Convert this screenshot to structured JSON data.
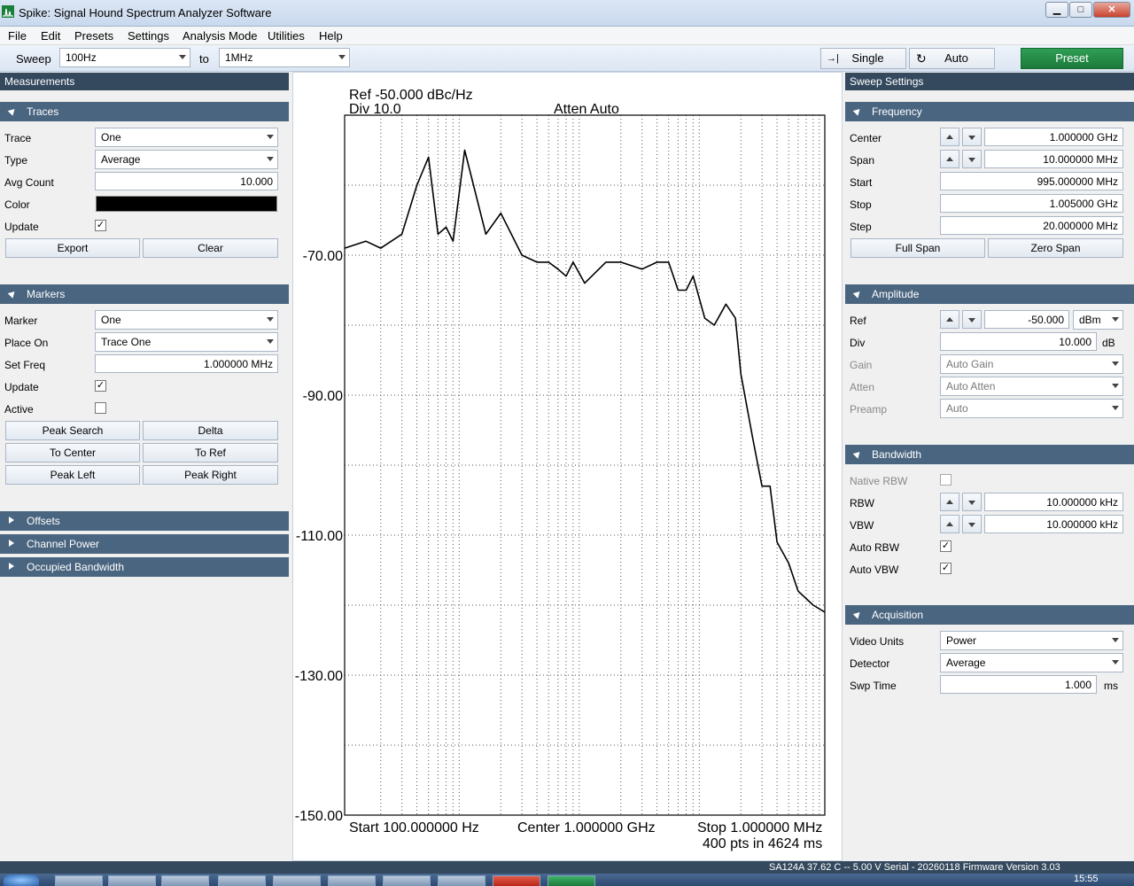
{
  "window": {
    "title": "Spike: Signal Hound Spectrum Analyzer Software",
    "minimize": "▁",
    "maximize": "□",
    "close": "✕"
  },
  "menu": [
    "File",
    "Edit",
    "Presets",
    "Settings",
    "Analysis Mode",
    "Utilities",
    "Help"
  ],
  "toolbar": {
    "sweep_label": "Sweep",
    "from": "100Hz",
    "to_label": "to",
    "to": "1MHz",
    "single": "Single",
    "auto": "Auto",
    "preset": "Preset"
  },
  "left": {
    "title": "Measurements",
    "traces": {
      "header": "Traces",
      "trace_label": "Trace",
      "trace": "One",
      "type_label": "Type",
      "type": "Average",
      "avg_label": "Avg Count",
      "avg": "10.000",
      "color_label": "Color",
      "update_label": "Update",
      "export": "Export",
      "clear": "Clear"
    },
    "markers": {
      "header": "Markers",
      "marker_label": "Marker",
      "marker": "One",
      "place_label": "Place On",
      "place": "Trace One",
      "setfreq_label": "Set Freq",
      "setfreq": "1.000000 MHz",
      "update_label": "Update",
      "active_label": "Active",
      "peak_search": "Peak Search",
      "delta": "Delta",
      "to_center": "To Center",
      "to_ref": "To Ref",
      "peak_left": "Peak Left",
      "peak_right": "Peak Right"
    },
    "offsets": "Offsets",
    "channel_power": "Channel Power",
    "occupied_bw": "Occupied Bandwidth"
  },
  "right": {
    "title": "Sweep Settings",
    "frequency": {
      "header": "Frequency",
      "center_label": "Center",
      "center": "1.000000 GHz",
      "span_label": "Span",
      "span": "10.000000 MHz",
      "start_label": "Start",
      "start": "995.000000 MHz",
      "stop_label": "Stop",
      "stop": "1.005000 GHz",
      "step_label": "Step",
      "step": "20.000000 MHz",
      "full_span": "Full Span",
      "zero_span": "Zero Span"
    },
    "amplitude": {
      "header": "Amplitude",
      "ref_label": "Ref",
      "ref": "-50.000",
      "ref_unit": "dBm",
      "div_label": "Div",
      "div": "10.000",
      "div_unit": "dB",
      "gain_label": "Gain",
      "gain": "Auto Gain",
      "atten_label": "Atten",
      "atten": "Auto Atten",
      "preamp_label": "Preamp",
      "preamp": "Auto"
    },
    "bandwidth": {
      "header": "Bandwidth",
      "native_label": "Native RBW",
      "rbw_label": "RBW",
      "rbw": "10.000000 kHz",
      "vbw_label": "VBW",
      "vbw": "10.000000 kHz",
      "auto_rbw_label": "Auto RBW",
      "auto_vbw_label": "Auto VBW"
    },
    "acquisition": {
      "header": "Acquisition",
      "video_label": "Video Units",
      "video": "Power",
      "detector_label": "Detector",
      "detector": "Average",
      "swp_label": "Swp Time",
      "swp": "1.000",
      "swp_unit": "ms"
    }
  },
  "plot": {
    "ref_text": "Ref -50.000 dBc/Hz",
    "div_text": "Div 10.0",
    "atten_text": "Atten Auto",
    "start_text": "Start 100.000000 Hz",
    "center_text": "Center 1.000000 GHz",
    "stop_text": "Stop 1.000000 MHz",
    "pts_text": "400 pts in 4624 ms"
  },
  "status": "SA124A   37.62 C  --  5.00 V   Serial - 20260118    Firmware Version 3.03",
  "clock": "15:55",
  "chart_data": {
    "type": "line",
    "x_scale": "log",
    "xlim": [
      100,
      1000000
    ],
    "ylim": [
      -150,
      -50
    ],
    "yticks": [
      "-70.00",
      "-90.00",
      "-110.00",
      "-130.00",
      "-150.00"
    ],
    "trace_color": "#000000",
    "x": [
      100,
      150,
      200,
      300,
      400,
      500,
      600,
      700,
      800,
      1000,
      1500,
      2000,
      3000,
      4000,
      5000,
      6000,
      7000,
      8000,
      10000,
      15000,
      20000,
      30000,
      40000,
      50000,
      60000,
      70000,
      80000,
      100000,
      120000,
      150000,
      180000,
      200000,
      250000,
      300000,
      350000,
      400000,
      500000,
      600000,
      800000,
      1000000
    ],
    "y": [
      -69,
      -68,
      -69,
      -67,
      -60,
      -56,
      -67,
      -66,
      -68,
      -55,
      -67,
      -64,
      -70,
      -71,
      -71,
      -72,
      -73,
      -71,
      -74,
      -71,
      -71,
      -72,
      -71,
      -71,
      -75,
      -75,
      -73,
      -79,
      -80,
      -77,
      -79,
      -87,
      -96,
      -103,
      -103,
      -111,
      -114,
      -118,
      -120,
      -121
    ]
  }
}
